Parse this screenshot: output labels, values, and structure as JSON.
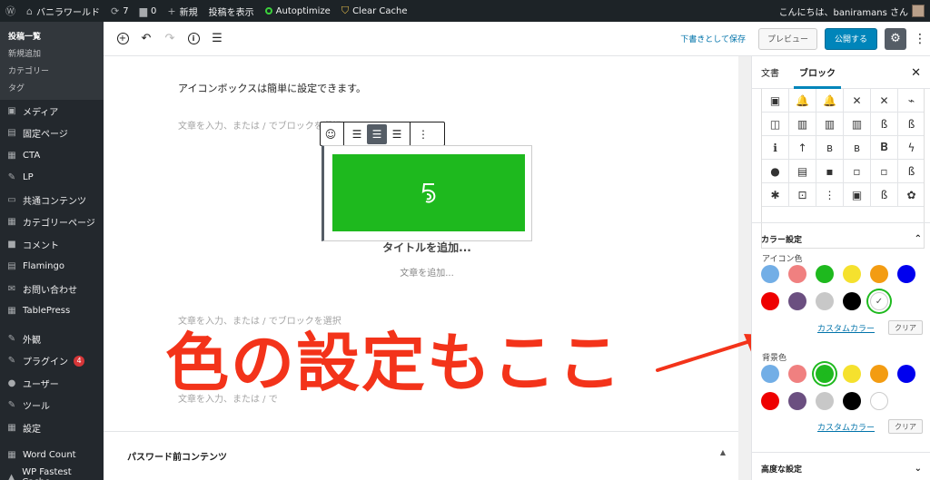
{
  "adminbar": {
    "site_name": "バニラワールド",
    "updates_count": "7",
    "comments_count": "0",
    "new_label": "新規",
    "view_post_label": "投稿を表示",
    "autoptimize_label": "Autoptimize",
    "clear_cache_label": "Clear Cache",
    "greeting": "こんにちは、baniramans さん"
  },
  "sidebar": {
    "submenu": [
      "投稿一覧",
      "新規追加",
      "カテゴリー",
      "タグ"
    ],
    "items": [
      {
        "label": "メディア",
        "icon": "media-icon",
        "glyph": "▣"
      },
      {
        "label": "固定ページ",
        "icon": "page-icon",
        "glyph": "▤"
      },
      {
        "label": "CTA",
        "icon": "cta-icon",
        "glyph": "▦"
      },
      {
        "label": "LP",
        "icon": "lp-icon",
        "glyph": "✎"
      },
      {
        "label": "共通コンテンツ",
        "icon": "folder-icon",
        "glyph": "▭"
      },
      {
        "label": "カテゴリーページ",
        "icon": "category-page-icon",
        "glyph": "▦"
      },
      {
        "label": "コメント",
        "icon": "comment-icon",
        "glyph": "■"
      },
      {
        "label": "Flamingo",
        "icon": "flamingo-icon",
        "glyph": "▤"
      },
      {
        "label": "お問い合わせ",
        "icon": "mail-icon",
        "glyph": "✉"
      },
      {
        "label": "TablePress",
        "icon": "table-icon",
        "glyph": "▦"
      },
      {
        "label": "外観",
        "icon": "appearance-icon",
        "glyph": "✎"
      },
      {
        "label": "プラグイン",
        "icon": "plugin-icon",
        "glyph": "✎",
        "badge": "4"
      },
      {
        "label": "ユーザー",
        "icon": "user-icon",
        "glyph": "●"
      },
      {
        "label": "ツール",
        "icon": "tools-icon",
        "glyph": "✎"
      },
      {
        "label": "設定",
        "icon": "settings-icon",
        "glyph": "▦"
      },
      {
        "label": "Word Count",
        "icon": "word-count-icon",
        "glyph": "▦"
      },
      {
        "label": "WP Fastest Cache",
        "icon": "cache-icon",
        "glyph": "▲"
      }
    ]
  },
  "toolbar": {
    "save_draft": "下書きとして保存",
    "preview": "プレビュー",
    "publish": "公開する"
  },
  "editor": {
    "intro_text": "アイコンボックスは簡単に設定できます。",
    "placeholder_top": "文章を入力、または / でブロックを選択",
    "iconbox_title": "タイトルを追加...",
    "iconbox_text": "文章を追加...",
    "placeholder_bottom": "文章を入力、または / でブロックを選択",
    "placeholder_partial": "文章を入力、または / で",
    "overlay_caption": "色の設定もここ",
    "meta_box_title": "パスワード前コンテンツ"
  },
  "panel": {
    "tab_document": "文書",
    "tab_block": "ブロック",
    "icons": [
      "▣",
      "🔔",
      "🔔",
      "✕",
      "✕",
      "⌁",
      "◫",
      "▥",
      "▥",
      "▥",
      "ß",
      "ß",
      "ℹ",
      "↑",
      "ʙ",
      "ʙ",
      "𝐁",
      "ϟ",
      "●",
      "▤",
      "▪",
      "▫",
      "▫",
      "ß",
      "✱",
      "⊡",
      "⋮",
      "▣",
      "ß",
      "✿"
    ],
    "color_section_title": "カラー設定",
    "icon_color_label": "アイコン色",
    "bg_color_label": "背景色",
    "custom_color": "カスタムカラー",
    "clear": "クリア",
    "advanced_title": "高度な設定",
    "palette": [
      "#72aee6",
      "#f08080",
      "#1eb91e",
      "#f5e12e",
      "#f39c12",
      "#0000ee",
      "#ee0000",
      "#6b4f80",
      "#c8c8c8",
      "#000000",
      "#ffffff"
    ],
    "icon_color_selected_index": 10,
    "bg_color_selected_index": 2
  }
}
